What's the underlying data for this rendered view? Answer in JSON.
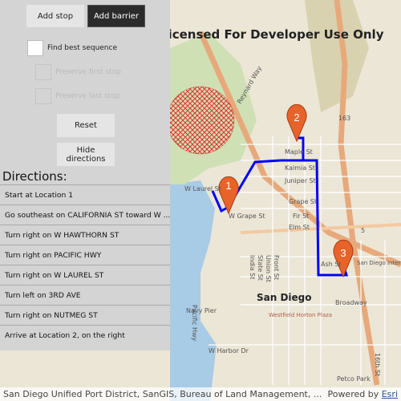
{
  "toolbar": {
    "add_stop": "Add stop",
    "add_barrier": "Add barrier",
    "reset": "Reset",
    "hide_directions": "Hide directions"
  },
  "options": {
    "find_best_sequence": "Find best sequence",
    "preserve_first_stop": "Preserve first stop",
    "preserve_last_stop": "Preserve last stop",
    "find_best_sequence_checked": false
  },
  "directions": {
    "title": "Directions:",
    "items": [
      "Start at Location 1",
      "Go southeast on CALIFORNIA ST toward W ...",
      "Turn right on W HAWTHORN ST",
      "Turn right on PACIFIC HWY",
      "Turn right on W LAUREL ST",
      "Turn left on 3RD AVE",
      "Turn right on NUTMEG ST",
      "Arrive at Location 2, on the right"
    ]
  },
  "map": {
    "watermark": "Licensed For Developer Use Only",
    "city": "San Diego",
    "stops": [
      "1",
      "2",
      "3"
    ],
    "labels": [
      "W Laurel St",
      "W Grape St",
      "Maple St",
      "Kalmia St",
      "Juniper St",
      "Grape St",
      "Fir St",
      "Elm St",
      "Ash St",
      "Broadway",
      "Pacific Hwy",
      "India St",
      "State St",
      "Union St",
      "Front St",
      "Navy Pier",
      "W Harbor Dr",
      "Reynard Way",
      "San Diego International",
      "Westfield Horton Plaza",
      "Petco Park",
      "163",
      "5",
      "16th St"
    ],
    "route_color": "#0000ff",
    "barrier_color": "#e03030",
    "stop_color": "#e8632a"
  },
  "attribution": {
    "text": "San Diego Unified Port District, SanGIS, Bureau of Land Management, ...",
    "powered": "Powered by ",
    "esri": "Esri"
  }
}
